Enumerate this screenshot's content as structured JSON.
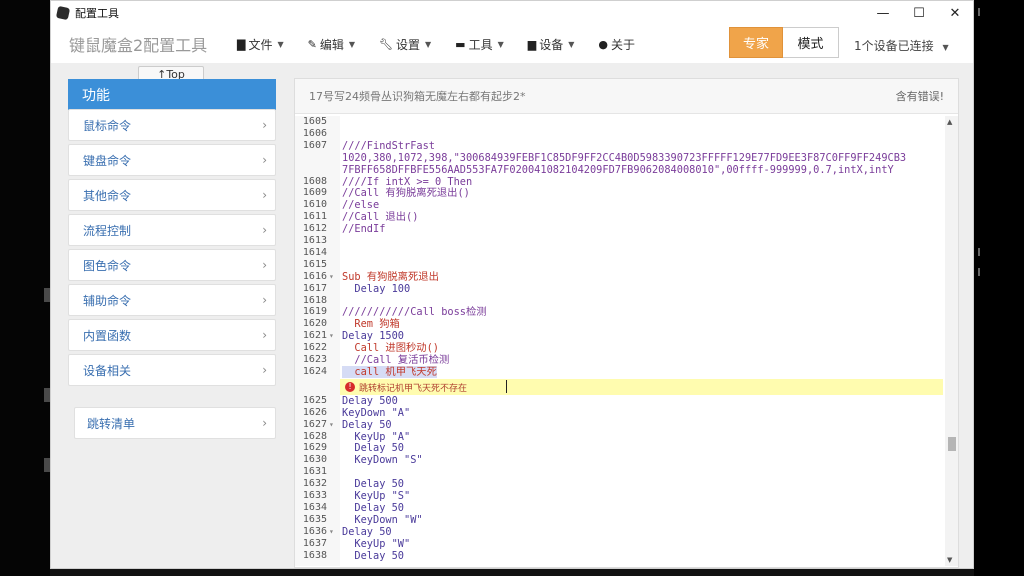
{
  "window": {
    "title": "配置工具",
    "controls": [
      "—",
      "☐",
      "✕"
    ]
  },
  "app": {
    "brand": "键鼠魔盒2配置工具",
    "menus": [
      {
        "label": "文件",
        "icon": "file-icon"
      },
      {
        "label": "编辑",
        "icon": "edit-icon"
      },
      {
        "label": "设置",
        "icon": "wrench-icon"
      },
      {
        "label": "工具",
        "icon": "toolbox-icon"
      },
      {
        "label": "设备",
        "icon": "device-icon"
      },
      {
        "label": "关于",
        "icon": "info-icon"
      }
    ],
    "mode_expert": "专家",
    "mode_label": "模式",
    "device_status": "1个设备已连接"
  },
  "sidebar": {
    "top_button": "↑Top",
    "header": "功能",
    "items": [
      "鼠标命令",
      "键盘命令",
      "其他命令",
      "流程控制",
      "图色命令",
      "辅助命令",
      "内置函数",
      "设备相关"
    ],
    "jump_list": "跳转清单"
  },
  "editor": {
    "script_title": "17号写24频骨丛识狗箱无魔左右都有起步2*",
    "error_status": "含有错误!",
    "error_message": "跳转标记机甲飞天死不存在",
    "lines": [
      {
        "n": "1605",
        "t": "",
        "c": "cmt"
      },
      {
        "n": "1606",
        "t": "",
        "c": "cmt"
      },
      {
        "n": "1607",
        "t": "////FindStrFast",
        "c": "cmt"
      },
      {
        "n": "",
        "t": "1020,380,1072,398,\"300684939FEBF1C85DF9FF2CC4B0D5983390723FFFFF129E77FD9EE3F87C0FF9FF249CB3",
        "c": "cmt"
      },
      {
        "n": "",
        "t": "7FBFF658DFFBFE556AAD553FA7F020041082104209FD7FB9062084008010\",00ffff-999999,0.7,intX,intY",
        "c": "cmt"
      },
      {
        "n": "1608",
        "t": "////If intX >= 0 Then",
        "c": "cmt"
      },
      {
        "n": "1609",
        "t": "//Call 有狗脱离死退出()",
        "c": "cmt"
      },
      {
        "n": "1610",
        "t": "//else",
        "c": "cmt"
      },
      {
        "n": "1611",
        "t": "//Call 退出()",
        "c": "cmt"
      },
      {
        "n": "1612",
        "t": "//EndIf",
        "c": "cmt"
      },
      {
        "n": "1613",
        "t": "",
        "c": "cmt"
      },
      {
        "n": "1614",
        "t": "",
        "c": "cmt"
      },
      {
        "n": "1615",
        "t": "",
        "c": "cmt"
      },
      {
        "n": "1616",
        "t": "Sub 有狗脱离死退出",
        "c": "sub",
        "fold": true
      },
      {
        "n": "1617",
        "t": "  Delay 100",
        "c": "delay"
      },
      {
        "n": "1618",
        "t": "",
        "c": "cmt"
      },
      {
        "n": "1619",
        "t": "///////////Call boss检测",
        "c": "cmt"
      },
      {
        "n": "1620",
        "t": "  Rem 狗箱",
        "c": "sub"
      },
      {
        "n": "1621",
        "t": "Delay 1500",
        "c": "delay",
        "fold": true
      },
      {
        "n": "1622",
        "t": "  Call 进图秒动()",
        "c": "sub"
      },
      {
        "n": "1623",
        "t": "  //Call 复活币检测",
        "c": "cmt"
      },
      {
        "n": "1624",
        "t": "  call 机甲飞天死",
        "c": "sub",
        "hl": true
      },
      {
        "n": "1625",
        "t": "Delay 500",
        "c": "delay"
      },
      {
        "n": "1626",
        "t": "KeyDown \"A\"",
        "c": "delay"
      },
      {
        "n": "1627",
        "t": "Delay 50",
        "c": "delay",
        "fold": true
      },
      {
        "n": "1628",
        "t": "  KeyUp \"A\"",
        "c": "delay"
      },
      {
        "n": "1629",
        "t": "  Delay 50",
        "c": "delay"
      },
      {
        "n": "1630",
        "t": "  KeyDown \"S\"",
        "c": "delay"
      },
      {
        "n": "1631",
        "t": "",
        "c": "cmt"
      },
      {
        "n": "1632",
        "t": "  Delay 50",
        "c": "delay"
      },
      {
        "n": "1633",
        "t": "  KeyUp \"S\"",
        "c": "delay"
      },
      {
        "n": "1634",
        "t": "  Delay 50",
        "c": "delay"
      },
      {
        "n": "1635",
        "t": "  KeyDown \"W\"",
        "c": "delay"
      },
      {
        "n": "1636",
        "t": "Delay 50",
        "c": "delay",
        "fold": true
      },
      {
        "n": "1637",
        "t": "  KeyUp \"W\"",
        "c": "delay"
      },
      {
        "n": "1638",
        "t": "  Delay 50",
        "c": "delay"
      }
    ]
  }
}
